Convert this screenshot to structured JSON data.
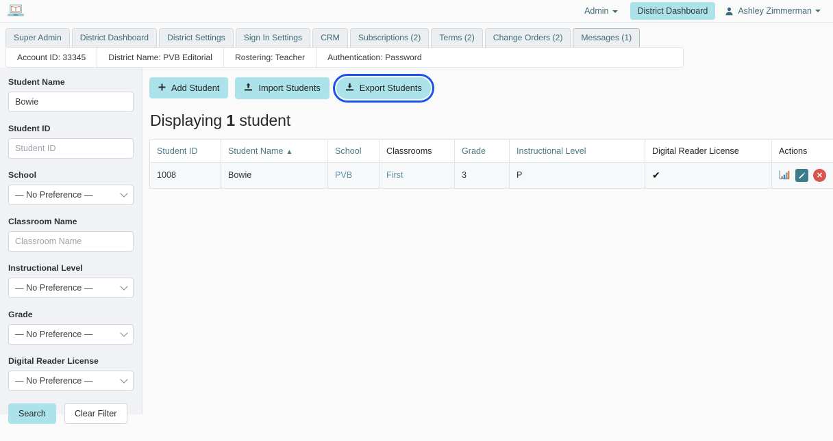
{
  "topbar": {
    "logo_icon": "book-laptop-logo",
    "admin_label": "Admin",
    "dashboard_pill": "District Dashboard",
    "user_name": "Ashley Zimmerman",
    "user_icon": "user-icon",
    "caret_icon": "caret-down-icon"
  },
  "tabs": [
    {
      "label": "Super Admin",
      "active": false
    },
    {
      "label": "District Dashboard",
      "active": false
    },
    {
      "label": "District Settings",
      "active": false
    },
    {
      "label": "Sign In Settings",
      "active": false
    },
    {
      "label": "CRM",
      "active": false
    },
    {
      "label": "Subscriptions (2)",
      "active": false
    },
    {
      "label": "Terms (2)",
      "active": false
    },
    {
      "label": "Change Orders (2)",
      "active": false
    },
    {
      "label": "Messages (1)",
      "active": true
    }
  ],
  "subbar": [
    "Account ID: 33345",
    "District Name: PVB Editorial",
    "Rostering: Teacher",
    "Authentication: Password"
  ],
  "sidebar": {
    "fields": [
      {
        "label": "Student Name",
        "type": "text",
        "value": "Bowie",
        "placeholder": "Student Name"
      },
      {
        "label": "Student ID",
        "type": "text",
        "value": "",
        "placeholder": "Student ID"
      },
      {
        "label": "School",
        "type": "select",
        "value": "— No Preference —"
      },
      {
        "label": "Classroom Name",
        "type": "text",
        "value": "",
        "placeholder": "Classroom Name"
      },
      {
        "label": "Instructional Level",
        "type": "select",
        "value": "— No Preference —"
      },
      {
        "label": "Grade",
        "type": "select",
        "value": "— No Preference —"
      },
      {
        "label": "Digital Reader License",
        "type": "select",
        "value": "— No Preference —"
      }
    ],
    "search_label": "Search",
    "clear_label": "Clear Filter"
  },
  "actions": {
    "add_label": "Add Student",
    "add_icon": "plus-icon",
    "import_label": "Import Students",
    "import_icon": "upload-icon",
    "export_label": "Export Students",
    "export_icon": "download-icon"
  },
  "heading": {
    "prefix": "Displaying",
    "count": "1",
    "suffix": "student"
  },
  "table": {
    "columns": [
      {
        "label": "Student ID",
        "sortable": true,
        "sorted": false
      },
      {
        "label": "Student Name",
        "sortable": true,
        "sorted": true,
        "sort_icon": "▲"
      },
      {
        "label": "School",
        "sortable": true,
        "sorted": false
      },
      {
        "label": "Classrooms",
        "sortable": false,
        "sorted": false
      },
      {
        "label": "Grade",
        "sortable": true,
        "sorted": false
      },
      {
        "label": "Instructional Level",
        "sortable": true,
        "sorted": false
      },
      {
        "label": "Digital Reader License",
        "sortable": false,
        "sorted": false
      },
      {
        "label": "Actions",
        "sortable": false,
        "sorted": false
      }
    ],
    "rows": [
      {
        "student_id": "1008",
        "student_name": "Bowie",
        "school": "PVB",
        "classrooms": "First",
        "grade": "3",
        "instructional_level": "P",
        "digital_reader_license": "✔",
        "action_icons": [
          "report-chart-icon",
          "edit-pencil-icon",
          "delete-x-icon"
        ]
      }
    ]
  },
  "colors": {
    "accent_cyan": "#ace3ea",
    "link_teal": "#4a7a88",
    "focus_blue": "#1a53e8",
    "danger_red": "#d9534f",
    "edit_teal": "#3c7b8a",
    "sidebar_bg": "#f0f2f5"
  }
}
